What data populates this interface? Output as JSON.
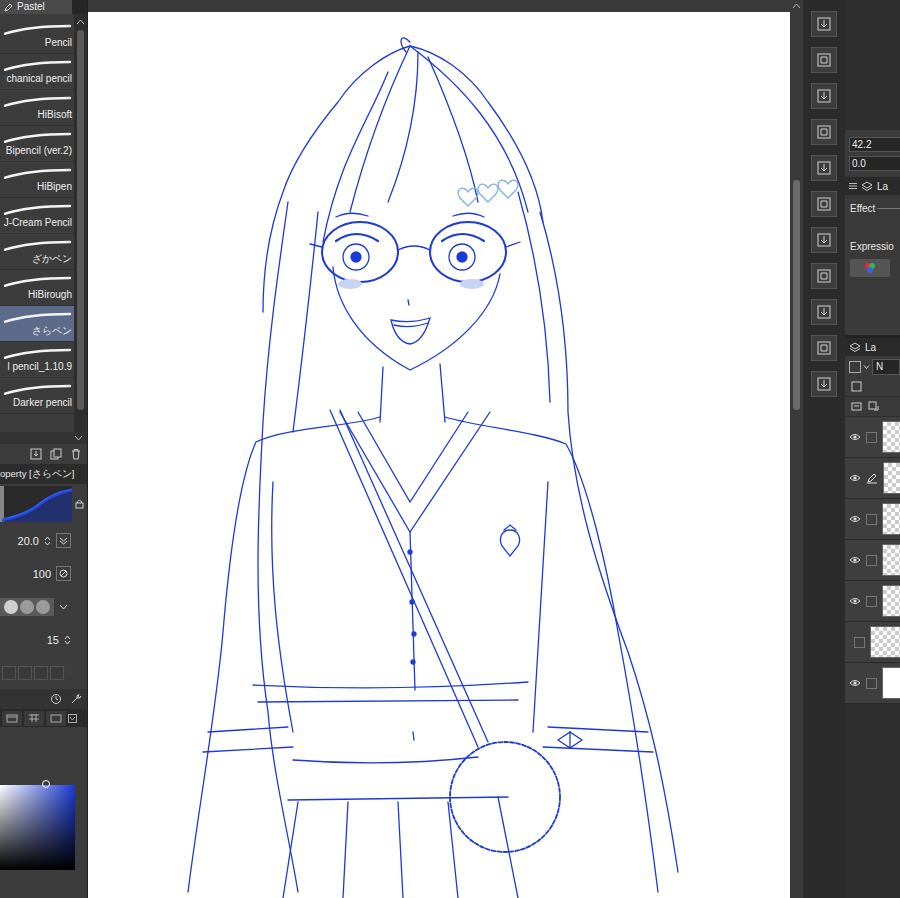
{
  "brush_group_tab": {
    "label": "Pastel"
  },
  "brushes": [
    {
      "name": "Pencil",
      "selected": false
    },
    {
      "name": "chanical pencil",
      "selected": false
    },
    {
      "name": "HiBisoft",
      "selected": false
    },
    {
      "name": "Bipencil (ver.2)",
      "selected": false
    },
    {
      "name": "HiBipen",
      "selected": false
    },
    {
      "name": "J-Cream Pencil",
      "selected": false
    },
    {
      "name": "ざかペン",
      "selected": false
    },
    {
      "name": "HiBirough",
      "selected": false
    },
    {
      "name": "さらペン",
      "selected": true
    },
    {
      "name": "l pencil_1.10.9",
      "selected": false
    },
    {
      "name": "Darker pencil",
      "selected": false
    }
  ],
  "tool_property": {
    "title": "operty [さらペン]",
    "size": "20.0",
    "opacity": "100",
    "shapes": [
      {
        "selected": true
      },
      {
        "selected": false
      },
      {
        "selected": false
      }
    ],
    "stabilization": "15"
  },
  "color": {
    "current": "#1c3ad6"
  },
  "navigator": {
    "zoom": "42.2",
    "rotation": "0.0"
  },
  "layer_property": {
    "tab": "La",
    "effect": "Effect",
    "expression": "Expressio"
  },
  "layers": {
    "tab": "La",
    "blend_mode": "N",
    "rows": [
      {
        "kind": "raster",
        "visible": true,
        "editing": false
      },
      {
        "kind": "raster",
        "visible": true,
        "editing": true
      },
      {
        "kind": "raster",
        "visible": true,
        "editing": false
      },
      {
        "kind": "raster",
        "visible": true,
        "editing": false
      },
      {
        "kind": "raster",
        "visible": true,
        "editing": false
      },
      {
        "kind": "raster",
        "visible": false,
        "editing": false
      },
      {
        "kind": "paper",
        "visible": true,
        "editing": false
      }
    ]
  }
}
